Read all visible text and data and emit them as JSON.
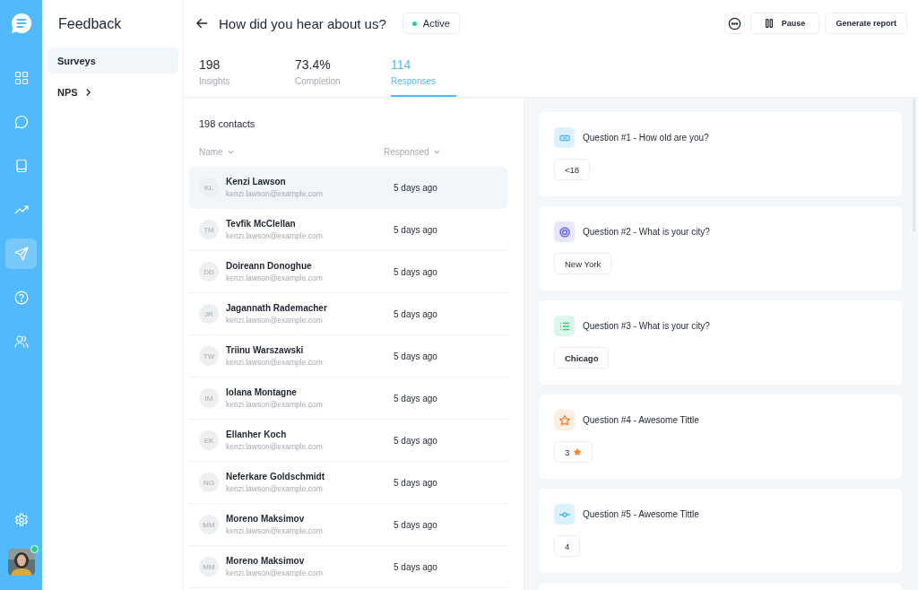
{
  "rail": {
    "items": [
      {
        "kind": "grid",
        "selected": false
      },
      {
        "kind": "chat",
        "selected": false
      },
      {
        "kind": "book",
        "selected": false
      },
      {
        "kind": "trend",
        "selected": false
      },
      {
        "kind": "send",
        "selected": true
      },
      {
        "kind": "help",
        "selected": false
      },
      {
        "kind": "users",
        "selected": false
      }
    ],
    "user": {
      "online": true
    }
  },
  "sidebar": {
    "title": "Feedback",
    "items": [
      {
        "label": "Surveys",
        "selected": true,
        "has_submenu": false
      },
      {
        "label": "NPS",
        "selected": false,
        "has_submenu": true
      }
    ]
  },
  "header": {
    "title": "How did you hear about us?",
    "status": "Active",
    "buttons": [
      "Pause",
      "Generate report"
    ]
  },
  "stats": [
    {
      "value": "198",
      "label": "Insights",
      "selected": false
    },
    {
      "value": "73.4%",
      "label": "Completion",
      "selected": false
    },
    {
      "value": "114",
      "label": "Responses",
      "selected": true
    }
  ],
  "contacts": {
    "count": "198 contacts",
    "columns": [
      "Name",
      "Responsed"
    ],
    "rows": [
      {
        "initials": "KL",
        "name": "Kenzi Lawson",
        "email": "kenzi.lawson@example.com",
        "responded": "5 days ago",
        "selected": true
      },
      {
        "initials": "TM",
        "name": "Tevfik McClellan",
        "email": "kenzi.lawson@example.com",
        "responded": "5 days ago",
        "selected": false
      },
      {
        "initials": "DD",
        "name": "Doireann Donoghue",
        "email": "kenzi.lawson@example.com",
        "responded": "5 days ago",
        "selected": false
      },
      {
        "initials": "JR",
        "name": "Jagannath Rademacher",
        "email": "kenzi.lawson@example.com",
        "responded": "5 days ago",
        "selected": false
      },
      {
        "initials": "TW",
        "name": "Triinu Warszawski",
        "email": "kenzi.lawson@example.com",
        "responded": "5 days ago",
        "selected": false
      },
      {
        "initials": "IM",
        "name": "Iolana Montagne",
        "email": "kenzi.lawson@example.com",
        "responded": "5 days ago",
        "selected": false
      },
      {
        "initials": "EK",
        "name": "Ellanher Koch",
        "email": "kenzi.lawson@example.com",
        "responded": "5 days ago",
        "selected": false
      },
      {
        "initials": "NG",
        "name": "Neferkare Goldschmidt",
        "email": "kenzi.lawson@example.com",
        "responded": "5 days ago",
        "selected": false
      },
      {
        "initials": "MM",
        "name": "Moreno Maksimov",
        "email": "kenzi.lawson@example.com",
        "responded": "5 days ago",
        "selected": false
      },
      {
        "initials": "MM",
        "name": "Moreno Maksimov",
        "email": "kenzi.lawson@example.com",
        "responded": "5 days ago",
        "selected": false
      }
    ]
  },
  "questions": [
    {
      "kind": "text",
      "title": "Question #1 - How old are you?",
      "answer": "<18"
    },
    {
      "kind": "radio",
      "title": "Question #2 - What is your city?",
      "answer": "New York"
    },
    {
      "kind": "list",
      "title": "Question #3 - What is your city?",
      "answer": "Chicago"
    },
    {
      "kind": "rating",
      "title": "Question #4 - Awesome Tittle",
      "answer": "3"
    },
    {
      "kind": "slider",
      "title": "Question #5 - Awesome Tittle",
      "answer": "4"
    }
  ]
}
